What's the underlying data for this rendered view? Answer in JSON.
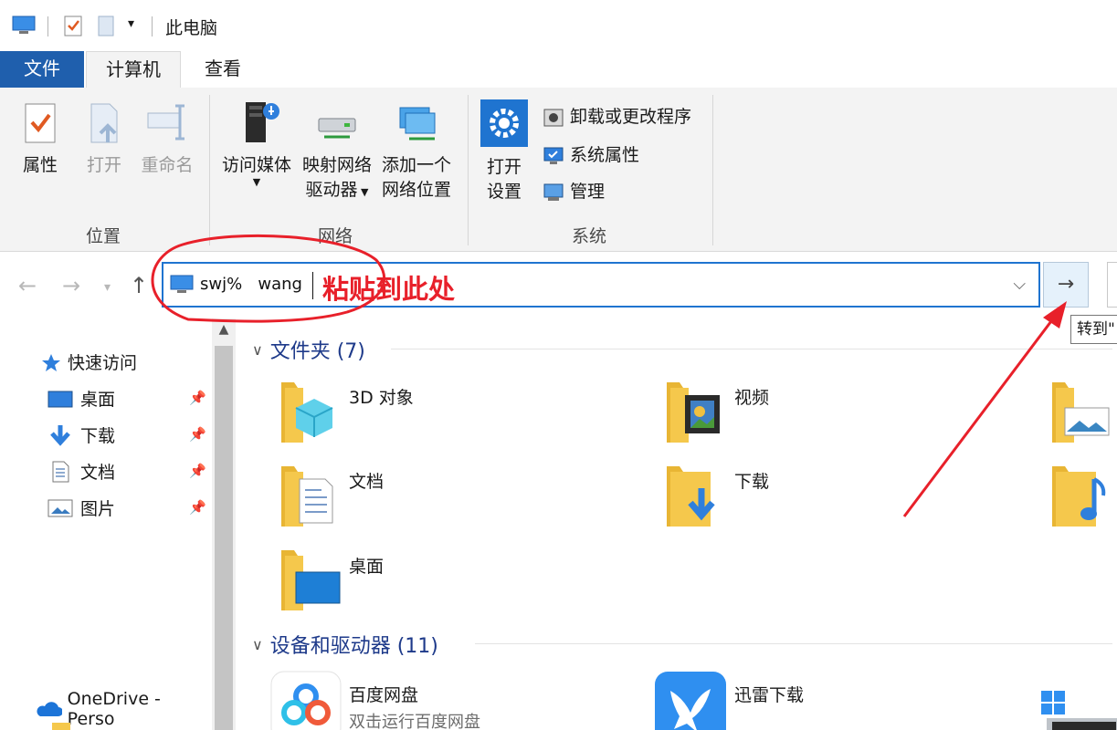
{
  "window": {
    "title": "此电脑"
  },
  "tabs": {
    "file": "文件",
    "computer": "计算机",
    "view": "查看"
  },
  "ribbon": {
    "location": {
      "label": "位置",
      "properties": "属性",
      "open": "打开",
      "rename": "重命名"
    },
    "network": {
      "label": "网络",
      "access_media": "访问媒体",
      "map_drive_1": "映射网络",
      "map_drive_2": "驱动器",
      "add_location_1": "添加一个",
      "add_location_2": "网络位置"
    },
    "system": {
      "label": "系统",
      "open_settings_1": "打开",
      "open_settings_2": "设置",
      "uninstall": "卸载或更改程序",
      "system_properties": "系统属性",
      "manage": "管理"
    }
  },
  "address": {
    "value": "swj%   wang",
    "hint": "粘贴到此处",
    "tooltip": "转到\""
  },
  "nav": {
    "quick_access": "快速访问",
    "items": [
      {
        "label": "桌面",
        "icon": "desktop-icon"
      },
      {
        "label": "下载",
        "icon": "download-icon"
      },
      {
        "label": "文档",
        "icon": "documents-icon"
      },
      {
        "label": "图片",
        "icon": "pictures-icon"
      }
    ],
    "onedrive": "OneDrive - Perso"
  },
  "folders": {
    "title": "文件夹 (7)",
    "items": [
      {
        "label": "3D 对象",
        "icon": "3d-objects-folder-icon"
      },
      {
        "label": "视频",
        "icon": "videos-folder-icon"
      },
      {
        "label": "文档",
        "icon": "documents-folder-icon"
      },
      {
        "label": "下载",
        "icon": "downloads-folder-icon"
      },
      {
        "label": "桌面",
        "icon": "desktop-folder-icon"
      }
    ]
  },
  "devices": {
    "title": "设备和驱动器 (11)",
    "items": [
      {
        "label": "百度网盘",
        "sub": "双击运行百度网盘",
        "icon": "baidu-netdisk-icon"
      },
      {
        "label": "迅雷下载",
        "icon": "xunlei-icon"
      }
    ]
  },
  "colors": {
    "accent": "#1f5fad",
    "annotation": "#e8202a",
    "folder": "#f5c84c"
  }
}
